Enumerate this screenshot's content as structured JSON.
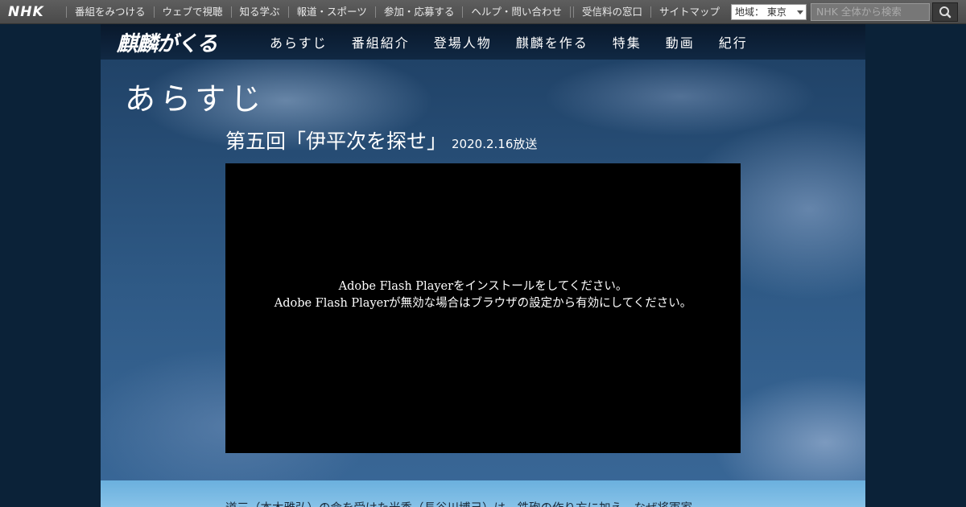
{
  "nhk_bar": {
    "logo": "NHK",
    "nav": [
      "番組をみつける",
      "ウェブで視聴",
      "知る学ぶ",
      "報道・スポーツ",
      "参加・応募する",
      "ヘルプ・問い合わせ"
    ],
    "nav_right": [
      "受信料の窓口",
      "サイトマップ"
    ],
    "region_label": "地域： 東京",
    "search_placeholder": "NHK 全体から検索",
    "search_icon": "search-icon"
  },
  "site": {
    "logo": "麒麟がくる",
    "nav": [
      "あらすじ",
      "番組紹介",
      "登場人物",
      "麒麟を作る",
      "特集",
      "動画",
      "紀行"
    ]
  },
  "page": {
    "heading": "あらすじ",
    "episode_title": "第五回「伊平次を探せ」",
    "episode_date": "2020.2.16放送",
    "player_message_1": "Adobe Flash Playerをインストールをしてください。",
    "player_message_2": "Adobe Flash Playerが無効な場合はブラウザの設定から有効にしてください。",
    "synopsis": "道三（本木雅弘）の命を受けた光秀（長谷川博己）は、鉄砲の作り方に加え、なぜ将軍家"
  }
}
